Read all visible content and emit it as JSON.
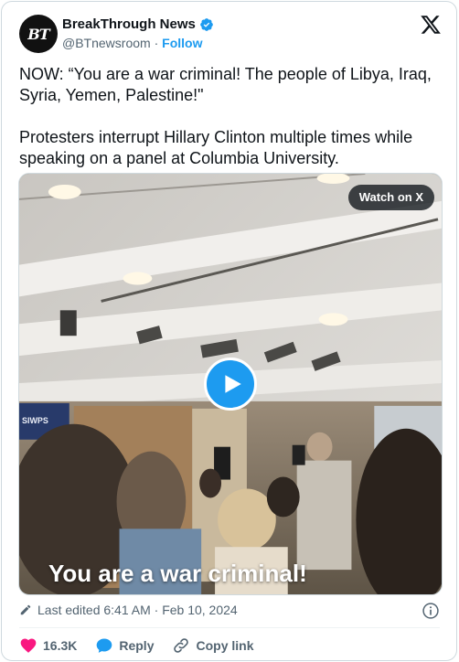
{
  "author": {
    "avatar_text": "BT",
    "display_name": "BreakThrough News",
    "handle": "@BTnewsroom",
    "separator": "·",
    "follow_label": "Follow",
    "verified": true
  },
  "platform_icon": "x-logo-icon",
  "tweet": {
    "paragraph_1": "NOW: “You are a war criminal! The people of Libya, Iraq, Syria, Yemen, Palestine!\"",
    "paragraph_2": "Protesters interrupt Hillary Clinton multiple times while speaking on a panel at Columbia University."
  },
  "media": {
    "watch_label": "Watch on X",
    "caption": "You are a war criminal!",
    "sign_text": "SIWPS",
    "play_icon": "play-icon"
  },
  "meta": {
    "edited_label": "Last edited 6:41 AM · Feb 10, 2024",
    "edit_icon": "pencil-icon",
    "info_icon": "info-icon"
  },
  "actions": {
    "like_count": "16.3K",
    "reply_label": "Reply",
    "copy_label": "Copy link"
  },
  "colors": {
    "accent": "#1d9bf0",
    "like": "#f91880",
    "text": "#0f1419",
    "muted": "#536471"
  }
}
